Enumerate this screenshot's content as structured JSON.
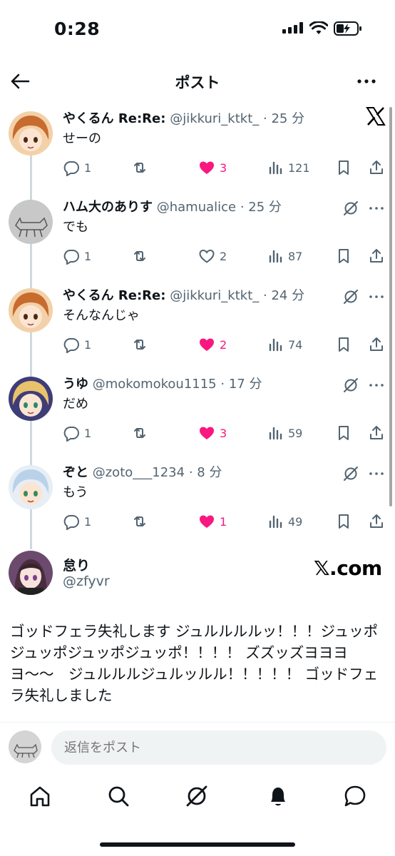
{
  "status_bar": {
    "time": "0:28"
  },
  "header": {
    "title": "ポスト"
  },
  "posts": [
    {
      "name": "やくるん Re:Re:",
      "handle": "@jikkuri_ktkt_",
      "time": "· 25 分",
      "text": "せーの",
      "replies": "1",
      "likes": "3",
      "liked": true,
      "views": "121"
    },
    {
      "name": "ハム大のありす",
      "handle": "@hamualice",
      "time": "· 25 分",
      "text": "でも",
      "replies": "1",
      "likes": "2",
      "liked": false,
      "views": "87"
    },
    {
      "name": "やくるん Re:Re:",
      "handle": "@jikkuri_ktkt_",
      "time": "· 24 分",
      "text": "そんなんじゃ",
      "replies": "1",
      "likes": "2",
      "liked": true,
      "views": "74"
    },
    {
      "name": "うゆ",
      "handle": "@mokomokou1115",
      "time": "· 17 分",
      "text": "だめ",
      "replies": "1",
      "likes": "3",
      "liked": true,
      "views": "59"
    },
    {
      "name": "ぞと",
      "handle": "@zoto___1234",
      "time": "· 8 分",
      "text": "もう",
      "replies": "1",
      "likes": "1",
      "liked": true,
      "views": "49"
    }
  ],
  "quoted": {
    "name": "怠り",
    "handle": "@zfyvr",
    "mark": "𝕏.com",
    "body": "ゴッドフェラ失礼します ジュルルルルッ！！！ジュッポジュッポジュッポジュッポ！！！！ ズズッズヨヨヨヨ〜〜　ジュルルルジュルッルル！！！！！ ゴッドフェラ失礼しました"
  },
  "reply_bar": {
    "placeholder": "返信をポスト"
  },
  "colors": {
    "like": "#f91880",
    "secondary": "#536471",
    "line": "#cfd9de"
  }
}
